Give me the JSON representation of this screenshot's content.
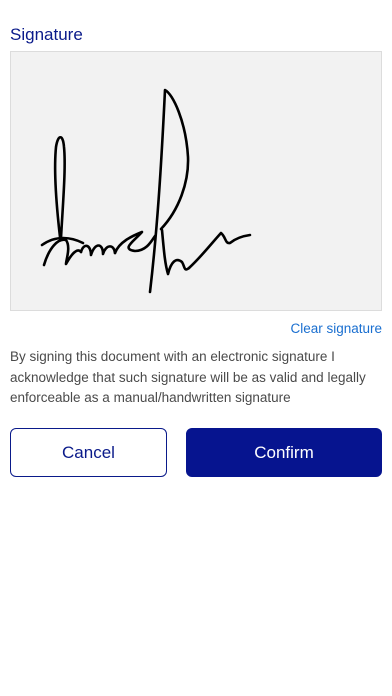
{
  "signature": {
    "title": "Signature",
    "clear_label": "Clear signature",
    "disclaimer": "By signing this document with an electronic signature I acknowledge that such signature will be as valid and legally enforceable as a manual/handwritten signature"
  },
  "actions": {
    "cancel_label": "Cancel",
    "confirm_label": "Confirm"
  },
  "colors": {
    "accent": "#06148f",
    "link": "#1a6fd0",
    "pad_background": "#f2f2f2",
    "ink": "#000000"
  }
}
